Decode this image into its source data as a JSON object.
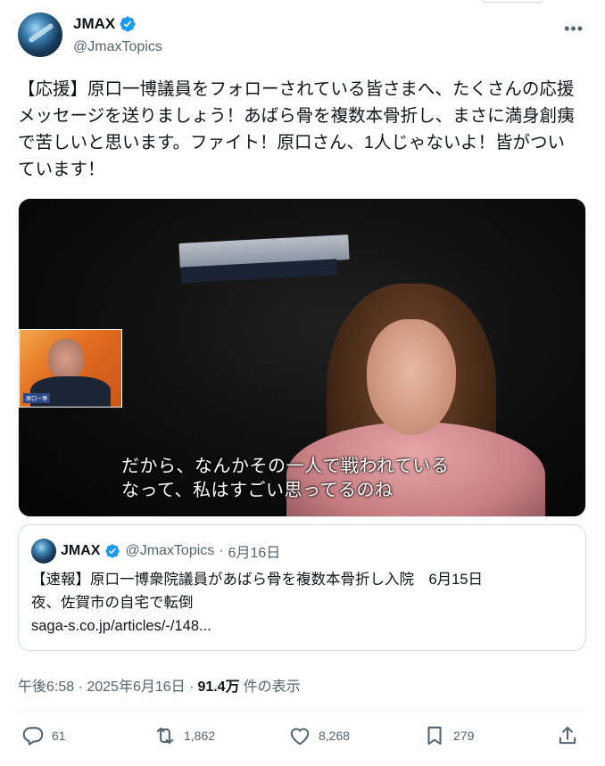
{
  "author": {
    "display_name": "JMAX",
    "handle": "@JmaxTopics"
  },
  "more_menu_icon": "ellipsis-icon",
  "tweet": {
    "text": "【応援】原口一博議員をフォローされている皆さまへ、たくさんの応援メッセージを送りましょう！あばら骨を複数本骨折し、まさに満身創痍で苦しいと思います。ファイト！原口さん、1人じゃないよ！皆がついています！"
  },
  "video": {
    "subtitle_line1": "だから、なんかその一人で戦われている",
    "subtitle_line2": "なって、私はすごい思ってるのね",
    "pip_label": "原口一博"
  },
  "quote": {
    "display_name": "JMAX",
    "handle": "@JmaxTopics",
    "separator": "·",
    "date": "6月16日",
    "text_line1": "【速報】原口一博衆院議員があばら骨を複数本骨折し入院　6月15日",
    "text_line2": "夜、佐賀市の自宅で転倒",
    "link": "saga-s.co.jp/articles/-/148..."
  },
  "meta": {
    "time": "午後6:58 · 2025年6月16日 ·",
    "views": "91.4万",
    "views_suffix": "件の表示"
  },
  "actions": {
    "replies": "61",
    "reposts": "1,862",
    "likes": "8,268",
    "bookmarks": "279"
  },
  "colors": {
    "verified_blue": "#1d9bf0",
    "secondary_text": "#536471",
    "primary_text": "#0f1419"
  }
}
